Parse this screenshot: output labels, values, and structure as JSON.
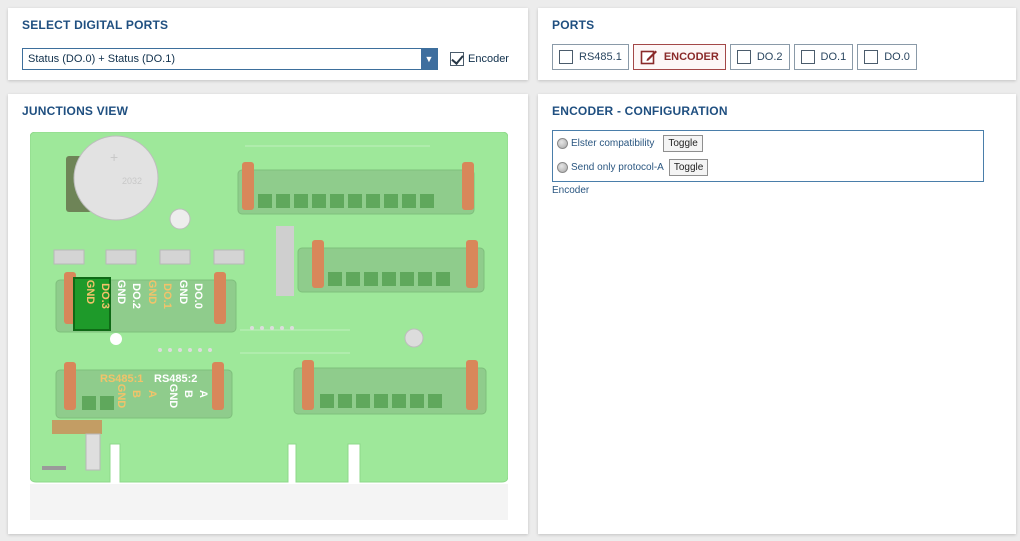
{
  "select_panel": {
    "title": "SELECT DIGITAL PORTS",
    "selected_value": "Status (DO.0) + Status (DO.1)",
    "dropdown_arrow": "▼",
    "encoder_checkbox_label": "Encoder",
    "encoder_checked": true
  },
  "ports_panel": {
    "title": "PORTS",
    "ports": [
      {
        "label": "RS485.1",
        "active": false
      },
      {
        "label": "ENCODER",
        "active": true
      },
      {
        "label": "DO.2",
        "active": false
      },
      {
        "label": "DO.1",
        "active": false
      },
      {
        "label": "DO.0",
        "active": false
      }
    ]
  },
  "junctions_panel": {
    "title": "JUNCTIONS VIEW",
    "board": {
      "battery_label": "2032",
      "do_labels": [
        "GND",
        "DO.3",
        "GND",
        "DO.2",
        "GND",
        "DO.1",
        "GND",
        "DO.0"
      ],
      "rs485_1_label": "RS485:1",
      "rs485_2_label": "RS485:2",
      "rs485_pins": [
        "GND",
        "B",
        "A",
        "GND",
        "B",
        "A"
      ]
    }
  },
  "config_panel": {
    "title": "ENCODER - CONFIGURATION",
    "options": [
      {
        "label": "Elster compatibility",
        "button": "Toggle"
      },
      {
        "label": "Send only protocol-A",
        "button": "Toggle"
      }
    ],
    "caption": "Encoder"
  },
  "colors": {
    "title": "#1f4f80",
    "board_green": "#9ee89a",
    "active_port_border": "#a34848",
    "highlight_green": "#1e9a2a"
  }
}
